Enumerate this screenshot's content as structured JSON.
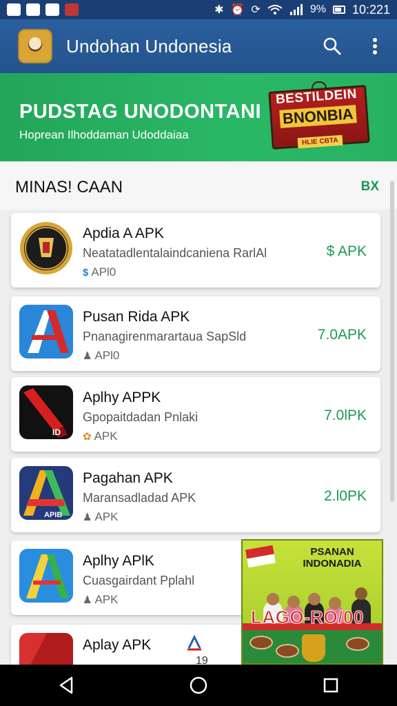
{
  "status_bar": {
    "battery": "9%",
    "time": "10:221"
  },
  "app_bar": {
    "title": "Undohan Undonesia"
  },
  "banner": {
    "title": "PUDSTAG UNODONTANI",
    "subtitle": "Hoprean Ilhoddaman Udoddaiaa",
    "badge_line1": "BESTILDEIN",
    "badge_line2": "BNONBIA",
    "badge_ribbon": "HLIE CBTA"
  },
  "section": {
    "title": "MINAS! CAAN",
    "action": "BX"
  },
  "apps": [
    {
      "name": "Apdia A APK",
      "desc": "Neatatadlentalaindcaniena RarlAl",
      "meta": "APl0",
      "meta_icon": "dollar-icon",
      "size": "$ APK",
      "icon_style": "emblem"
    },
    {
      "name": "Pusan Rida APK",
      "desc": "Pnanagirenmarartaua SapSld",
      "meta": "APl0",
      "meta_icon": "person-icon",
      "size": "7.0APK",
      "icon_style": "blue-a"
    },
    {
      "name": "Aplhy APPK",
      "desc": "Gpopaitdadan Pnlaki",
      "meta": "APK",
      "meta_icon": "gift-icon",
      "size": "7.0lPK",
      "icon_style": "red-black"
    },
    {
      "name": "Pagahan APK",
      "desc": "Maransadladad APK",
      "meta": "APK",
      "meta_icon": "person-icon",
      "size": "2.l0PK",
      "icon_style": "multi-a"
    },
    {
      "name": "Aplhy APlK",
      "desc": "Cuasgairdant Pplahl",
      "meta": "APK",
      "meta_icon": "person-icon",
      "size": "",
      "icon_style": "blue-green"
    },
    {
      "name": "Aplay APK",
      "desc": "",
      "meta": "",
      "meta_icon": "",
      "size": "",
      "icon_style": "red"
    }
  ],
  "partial_row_marks": {
    "number": "19"
  },
  "ad": {
    "title_line1": "PSANAN",
    "title_line2": "INDONADIA",
    "promo": "LAGO-RO/00"
  },
  "colors": {
    "status_bar": "#1a3f75",
    "app_bar": "#24538b",
    "banner": "#2ab866",
    "accent_green": "#1a9a53"
  }
}
